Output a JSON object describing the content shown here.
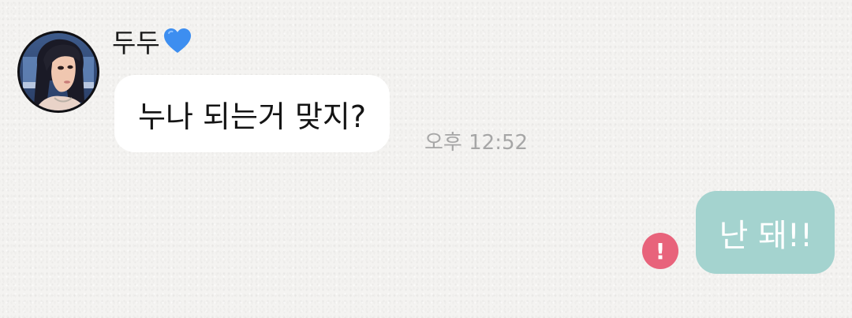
{
  "incoming_message": {
    "sender_name": "두두",
    "sender_name_icon": "blue-heart-icon",
    "text": "누나 되는거 맞지?",
    "time": "오후 12:52",
    "avatar": "profile-photo"
  },
  "outgoing_message": {
    "text": "난 돼!!",
    "status_icon": "error-exclamation-icon",
    "status_symbol": "!"
  },
  "colors": {
    "background": "#f4f3f1",
    "incoming_bubble": "#ffffff",
    "outgoing_bubble": "#a4d3cf",
    "error_badge": "#e8637b",
    "timestamp": "#a6a6a6",
    "heart": "#3d8ef0"
  }
}
